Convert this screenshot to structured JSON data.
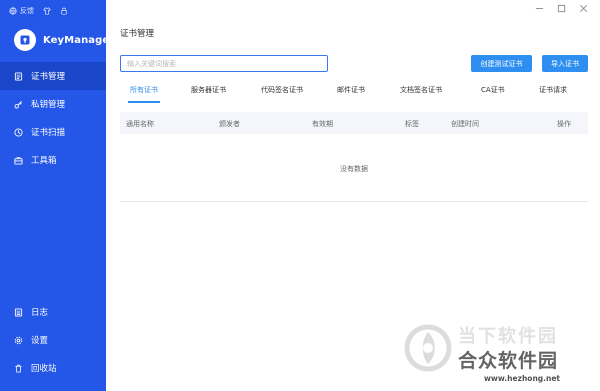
{
  "sidebar": {
    "feedback_label": "反馈",
    "brand": "KeyManager",
    "items": [
      {
        "label": "证书管理",
        "icon": "certificate-icon",
        "active": true
      },
      {
        "label": "私钥管理",
        "icon": "key-icon",
        "active": false
      },
      {
        "label": "证书扫描",
        "icon": "clock-icon",
        "active": false
      },
      {
        "label": "工具箱",
        "icon": "toolbox-icon",
        "active": false
      }
    ],
    "bottom_items": [
      {
        "label": "日志",
        "icon": "log-icon"
      },
      {
        "label": "设置",
        "icon": "gear-icon"
      },
      {
        "label": "回收站",
        "icon": "trash-icon"
      }
    ],
    "colors": {
      "bg": "#2456e8",
      "active": "#1a46c9"
    }
  },
  "main": {
    "title": "证书管理",
    "search": {
      "placeholder": "输入关键词搜索",
      "value": ""
    },
    "buttons": {
      "create_test": "创建测试证书",
      "import": "导入证书"
    },
    "tabs": [
      "所有证书",
      "服务器证书",
      "代码签名证书",
      "邮件证书",
      "文档签名证书",
      "CA证书",
      "证书请求"
    ],
    "active_tab": 0,
    "table": {
      "columns": [
        "通用名称",
        "颁发者",
        "有效期",
        "标签",
        "创建时间",
        "操作"
      ],
      "empty_text": "没有数据"
    },
    "accent": "#2e8ff0"
  },
  "window": {
    "controls": [
      "minimize",
      "maximize",
      "close"
    ]
  },
  "watermark": {
    "line1": "当下软件园",
    "line2": "合众软件园",
    "url": "www.hezhong.net"
  }
}
